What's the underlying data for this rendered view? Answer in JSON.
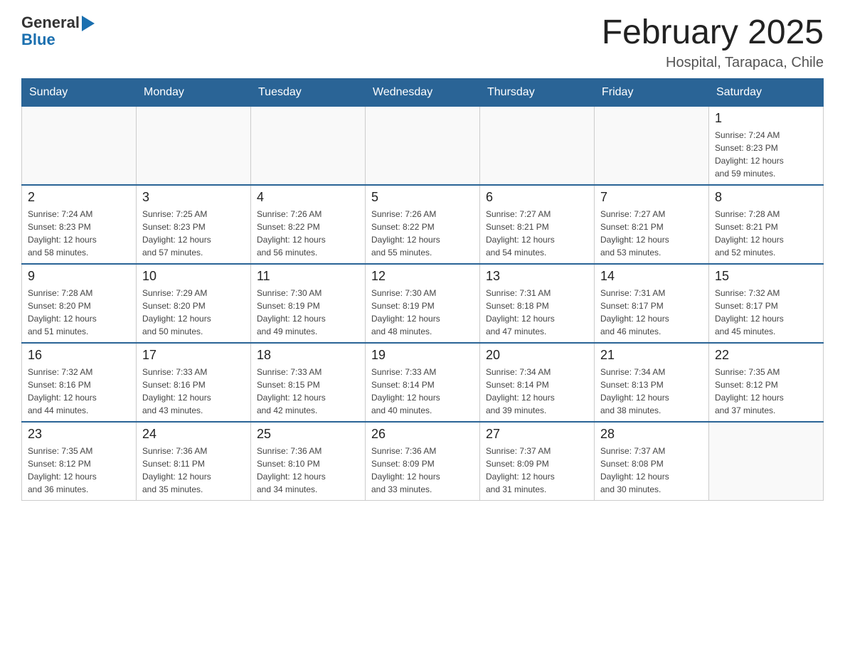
{
  "header": {
    "logo": {
      "general": "General",
      "blue": "Blue"
    },
    "title": "February 2025",
    "subtitle": "Hospital, Tarapaca, Chile"
  },
  "weekdays": [
    "Sunday",
    "Monday",
    "Tuesday",
    "Wednesday",
    "Thursday",
    "Friday",
    "Saturday"
  ],
  "weeks": [
    [
      {
        "day": "",
        "info": ""
      },
      {
        "day": "",
        "info": ""
      },
      {
        "day": "",
        "info": ""
      },
      {
        "day": "",
        "info": ""
      },
      {
        "day": "",
        "info": ""
      },
      {
        "day": "",
        "info": ""
      },
      {
        "day": "1",
        "info": "Sunrise: 7:24 AM\nSunset: 8:23 PM\nDaylight: 12 hours\nand 59 minutes."
      }
    ],
    [
      {
        "day": "2",
        "info": "Sunrise: 7:24 AM\nSunset: 8:23 PM\nDaylight: 12 hours\nand 58 minutes."
      },
      {
        "day": "3",
        "info": "Sunrise: 7:25 AM\nSunset: 8:23 PM\nDaylight: 12 hours\nand 57 minutes."
      },
      {
        "day": "4",
        "info": "Sunrise: 7:26 AM\nSunset: 8:22 PM\nDaylight: 12 hours\nand 56 minutes."
      },
      {
        "day": "5",
        "info": "Sunrise: 7:26 AM\nSunset: 8:22 PM\nDaylight: 12 hours\nand 55 minutes."
      },
      {
        "day": "6",
        "info": "Sunrise: 7:27 AM\nSunset: 8:21 PM\nDaylight: 12 hours\nand 54 minutes."
      },
      {
        "day": "7",
        "info": "Sunrise: 7:27 AM\nSunset: 8:21 PM\nDaylight: 12 hours\nand 53 minutes."
      },
      {
        "day": "8",
        "info": "Sunrise: 7:28 AM\nSunset: 8:21 PM\nDaylight: 12 hours\nand 52 minutes."
      }
    ],
    [
      {
        "day": "9",
        "info": "Sunrise: 7:28 AM\nSunset: 8:20 PM\nDaylight: 12 hours\nand 51 minutes."
      },
      {
        "day": "10",
        "info": "Sunrise: 7:29 AM\nSunset: 8:20 PM\nDaylight: 12 hours\nand 50 minutes."
      },
      {
        "day": "11",
        "info": "Sunrise: 7:30 AM\nSunset: 8:19 PM\nDaylight: 12 hours\nand 49 minutes."
      },
      {
        "day": "12",
        "info": "Sunrise: 7:30 AM\nSunset: 8:19 PM\nDaylight: 12 hours\nand 48 minutes."
      },
      {
        "day": "13",
        "info": "Sunrise: 7:31 AM\nSunset: 8:18 PM\nDaylight: 12 hours\nand 47 minutes."
      },
      {
        "day": "14",
        "info": "Sunrise: 7:31 AM\nSunset: 8:17 PM\nDaylight: 12 hours\nand 46 minutes."
      },
      {
        "day": "15",
        "info": "Sunrise: 7:32 AM\nSunset: 8:17 PM\nDaylight: 12 hours\nand 45 minutes."
      }
    ],
    [
      {
        "day": "16",
        "info": "Sunrise: 7:32 AM\nSunset: 8:16 PM\nDaylight: 12 hours\nand 44 minutes."
      },
      {
        "day": "17",
        "info": "Sunrise: 7:33 AM\nSunset: 8:16 PM\nDaylight: 12 hours\nand 43 minutes."
      },
      {
        "day": "18",
        "info": "Sunrise: 7:33 AM\nSunset: 8:15 PM\nDaylight: 12 hours\nand 42 minutes."
      },
      {
        "day": "19",
        "info": "Sunrise: 7:33 AM\nSunset: 8:14 PM\nDaylight: 12 hours\nand 40 minutes."
      },
      {
        "day": "20",
        "info": "Sunrise: 7:34 AM\nSunset: 8:14 PM\nDaylight: 12 hours\nand 39 minutes."
      },
      {
        "day": "21",
        "info": "Sunrise: 7:34 AM\nSunset: 8:13 PM\nDaylight: 12 hours\nand 38 minutes."
      },
      {
        "day": "22",
        "info": "Sunrise: 7:35 AM\nSunset: 8:12 PM\nDaylight: 12 hours\nand 37 minutes."
      }
    ],
    [
      {
        "day": "23",
        "info": "Sunrise: 7:35 AM\nSunset: 8:12 PM\nDaylight: 12 hours\nand 36 minutes."
      },
      {
        "day": "24",
        "info": "Sunrise: 7:36 AM\nSunset: 8:11 PM\nDaylight: 12 hours\nand 35 minutes."
      },
      {
        "day": "25",
        "info": "Sunrise: 7:36 AM\nSunset: 8:10 PM\nDaylight: 12 hours\nand 34 minutes."
      },
      {
        "day": "26",
        "info": "Sunrise: 7:36 AM\nSunset: 8:09 PM\nDaylight: 12 hours\nand 33 minutes."
      },
      {
        "day": "27",
        "info": "Sunrise: 7:37 AM\nSunset: 8:09 PM\nDaylight: 12 hours\nand 31 minutes."
      },
      {
        "day": "28",
        "info": "Sunrise: 7:37 AM\nSunset: 8:08 PM\nDaylight: 12 hours\nand 30 minutes."
      },
      {
        "day": "",
        "info": ""
      }
    ]
  ]
}
